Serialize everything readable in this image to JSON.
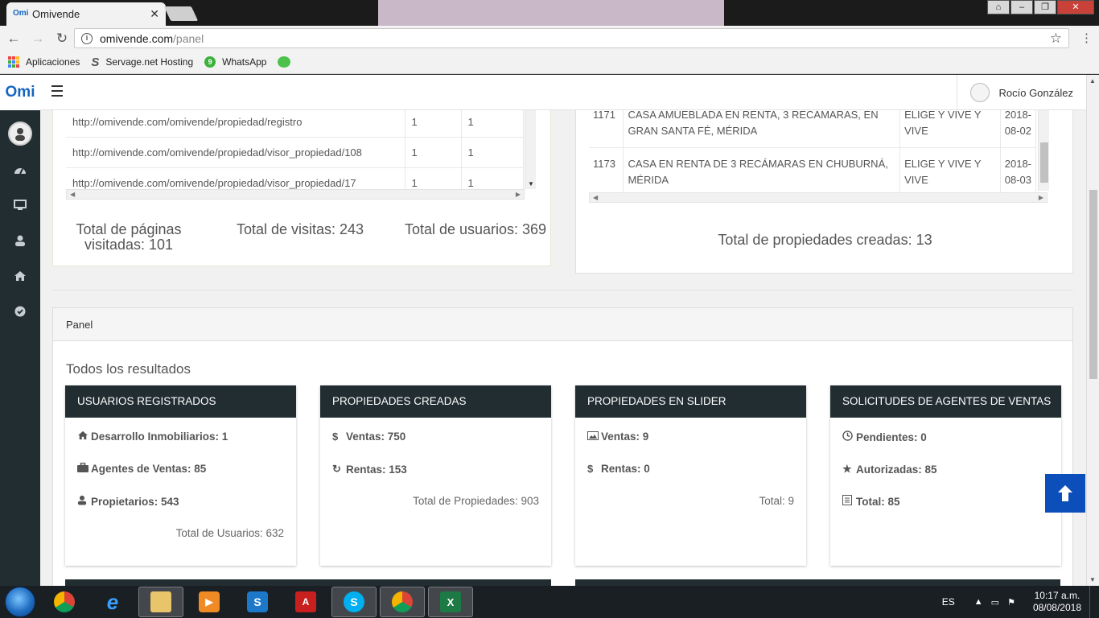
{
  "browser": {
    "tab_title": "Omivende",
    "tab_favicon": "Omi",
    "url_host": "omivende.com",
    "url_path": "/panel",
    "bookmarks": [
      {
        "label": "Aplicaciones",
        "icon": "apps-grid-icon"
      },
      {
        "label": "Servage.net Hosting",
        "icon": "servage-icon"
      },
      {
        "label": "WhatsApp",
        "icon": "whatsapp-icon"
      },
      {
        "label": "",
        "icon": "wechat-icon"
      }
    ]
  },
  "app": {
    "logo": "Omi",
    "user_name": "Rocío González",
    "sidebar_icons": [
      "avatar",
      "dashboard-icon",
      "monitor-icon",
      "user-icon",
      "home-icon",
      "check-circle-icon"
    ]
  },
  "pages_table": {
    "rows": [
      {
        "url": "http://omivende.com/omivende/propiedad/registro",
        "a": "1",
        "b": "1"
      },
      {
        "url": "http://omivende.com/omivende/propiedad/visor_propiedad/108",
        "a": "1",
        "b": "1"
      },
      {
        "url": "http://omivende.com/omivende/propiedad/visor_propiedad/17",
        "a": "1",
        "b": "1"
      }
    ],
    "total_pages_line1": "Total de páginas",
    "total_pages_line2": "visitadas: 101",
    "total_visits": "Total de visitas: 243",
    "total_users": "Total de usuarios: 369"
  },
  "properties_table": {
    "rows": [
      {
        "id": "1171",
        "title": "CASA AMUEBLADA EN RENTA, 3 RECÁMARAS, EN GRAN SANTA FÉ, MÉRIDA",
        "agency": "ELIGE Y VIVE Y VIVE",
        "date": "2018-08-02"
      },
      {
        "id": "1173",
        "title": "CASA EN RENTA DE 3 RECÁMARAS EN CHUBURNÁ, MÉRIDA",
        "agency": "ELIGE Y VIVE Y VIVE",
        "date": "2018-08-03"
      }
    ],
    "total": "Total de propiedades creadas: 13"
  },
  "panel": {
    "heading": "Panel",
    "subtitle": "Todos los resultados",
    "cards": [
      {
        "title": "USUARIOS REGISTRADOS",
        "rows": [
          {
            "icon": "home-icon",
            "text": "Desarrollo Inmobiliarios: 1"
          },
          {
            "icon": "briefcase-icon",
            "text": "Agentes de Ventas: 85"
          },
          {
            "icon": "user-icon",
            "text": "Propietarios: 543"
          }
        ],
        "total": "Total de Usuarios: 632"
      },
      {
        "title": "PROPIEDADES CREADAS",
        "rows": [
          {
            "icon": "dollar-icon",
            "text": "Ventas: 750"
          },
          {
            "icon": "refresh-icon",
            "text": "Rentas: 153"
          }
        ],
        "total": "Total de Propiedades: 903"
      },
      {
        "title": "PROPIEDADES EN SLIDER",
        "rows": [
          {
            "icon": "image-icon",
            "text": "Ventas: 9"
          },
          {
            "icon": "dollar-icon",
            "text": "Rentas: 0"
          }
        ],
        "total": "Total: 9"
      },
      {
        "title": "SOLICITUDES DE AGENTES DE VENTAS",
        "rows": [
          {
            "icon": "clock-icon",
            "text": "Pendientes: 0"
          },
          {
            "icon": "star-icon",
            "text": "Autorizadas: 85"
          },
          {
            "icon": "list-icon",
            "text": "Total: 85"
          }
        ],
        "total": ""
      }
    ]
  },
  "taskbar": {
    "language": "ES",
    "time": "10:17 a.m.",
    "date": "08/08/2018",
    "apps": [
      "chrome-icon",
      "ie-icon",
      "explorer-icon",
      "media-player-icon",
      "app-icon",
      "acrobat-icon",
      "skype-icon",
      "chrome-icon",
      "excel-icon"
    ]
  },
  "colors": {
    "sidebar_bg": "#222d32",
    "card_header_bg": "#222d32",
    "back_to_top_bg": "#0d4fba",
    "brand": "#1565c0"
  }
}
